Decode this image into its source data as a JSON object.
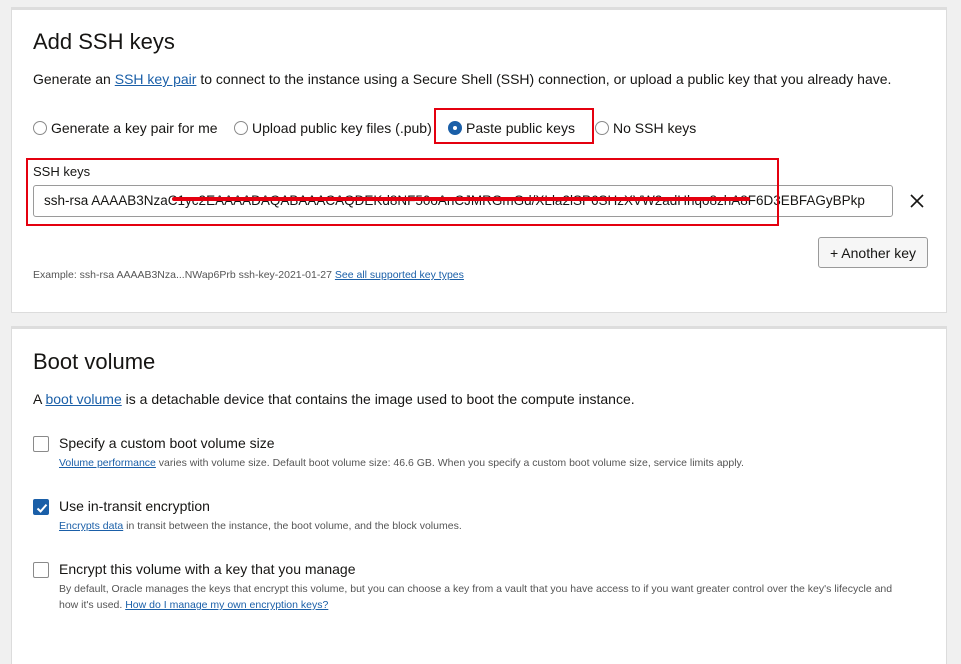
{
  "ssh_section": {
    "title": "Add SSH keys",
    "description_prefix": "Generate an ",
    "description_link": "SSH key pair",
    "description_suffix": " to connect to the instance using a Secure Shell (SSH) connection, or upload a public key that you already have.",
    "options": [
      {
        "label": "Generate a key pair for me",
        "selected": false
      },
      {
        "label": "Upload public key files (.pub)",
        "selected": false
      },
      {
        "label": "Paste public keys",
        "selected": true
      },
      {
        "label": "No SSH keys",
        "selected": false
      }
    ],
    "field_label": "SSH keys",
    "field_value": "ssh-rsa AAAAB3NzaC1yc2EAAAADAQABAAACAQDEKd8NF50oAnCJMRGmGd/XLla2lSP6SHzXVW2adHhqo8zhA8F6D3EBFAGyBPkp",
    "remove_icon": "close-icon",
    "add_button": "+ Another key",
    "example_text": "Example: ssh-rsa AAAAB3Nza...NWap6Prb ssh-key-2021-01-27 ",
    "example_link": "See all supported key types"
  },
  "boot_section": {
    "title": "Boot volume",
    "description_prefix": "A ",
    "description_link": "boot volume",
    "description_suffix": " is a detachable device that contains the image used to boot the compute instance.",
    "checkboxes": [
      {
        "label": "Specify a custom boot volume size",
        "checked": false,
        "help_link": "Volume performance",
        "help_text": " varies with volume size. Default boot volume size: 46.6 GB. When you specify a custom boot volume size, service limits apply."
      },
      {
        "label": "Use in-transit encryption",
        "checked": true,
        "help_link": "Encrypts data",
        "help_text": " in transit between the instance, the boot volume, and the block volumes."
      },
      {
        "label": "Encrypt this volume with a key that you manage",
        "checked": false,
        "help_text_line1": "By default, Oracle manages the keys that encrypt this volume, but you can choose a key from a vault that you have access to if you want greater control over the key's lifecycle and",
        "help_text_line2": "how it's used. ",
        "help_link": "How do I manage my own encryption keys?"
      }
    ]
  },
  "colors": {
    "accent": "#1a5fa8",
    "annotation_red": "#e4000f",
    "background": "#f0f0f0"
  }
}
